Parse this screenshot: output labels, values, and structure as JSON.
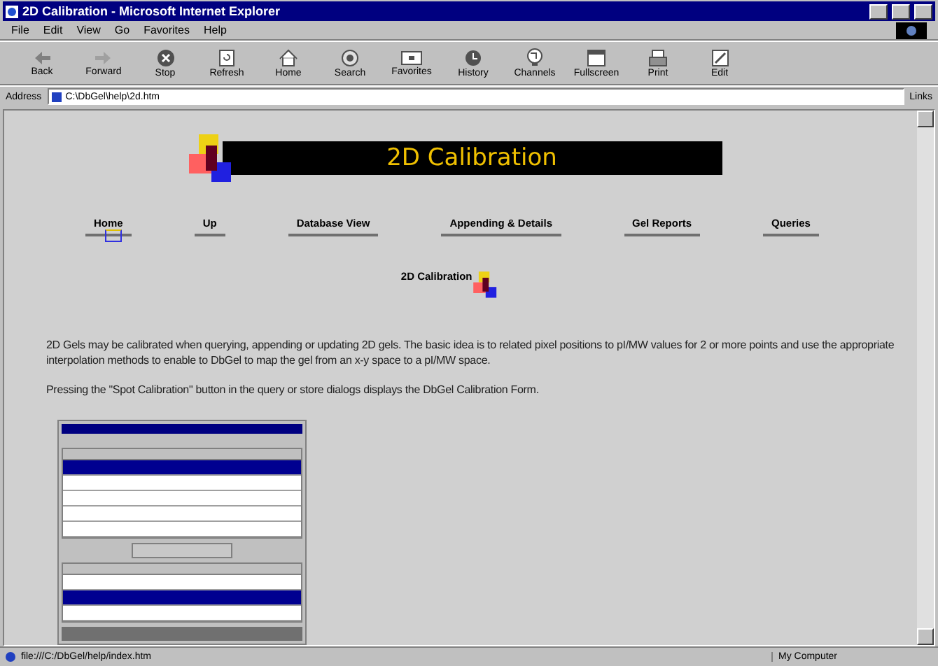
{
  "window": {
    "title": "2D Calibration - Microsoft Internet Explorer"
  },
  "menu": [
    "File",
    "Edit",
    "View",
    "Go",
    "Favorites",
    "Help"
  ],
  "toolbar": [
    {
      "label": "Back",
      "kind": "back"
    },
    {
      "label": "Forward",
      "kind": "forward"
    },
    {
      "label": "Stop",
      "kind": "stop"
    },
    {
      "label": "Refresh",
      "kind": "refresh"
    },
    {
      "label": "Home",
      "kind": "home"
    },
    {
      "label": "Search",
      "kind": "search"
    },
    {
      "label": "Favorites",
      "kind": "favorites"
    },
    {
      "label": "History",
      "kind": "history"
    },
    {
      "label": "Channels",
      "kind": "channels"
    },
    {
      "label": "Fullscreen",
      "kind": "fullscreen"
    },
    {
      "label": "Print",
      "kind": "print"
    },
    {
      "label": "Edit",
      "kind": "edit"
    }
  ],
  "address": {
    "label": "Address",
    "value": "C:\\DbGel\\help\\2d.htm",
    "links": "Links"
  },
  "page": {
    "banner": "2D Calibration",
    "nav": [
      {
        "label": "Home",
        "selected": true
      },
      {
        "label": "Up",
        "selected": false
      },
      {
        "label": "Database View",
        "selected": false
      },
      {
        "label": "Appending & Details",
        "selected": false
      },
      {
        "label": "Gel Reports",
        "selected": false
      },
      {
        "label": "Queries",
        "selected": false
      }
    ],
    "subnav": "2D Calibration",
    "paragraphs": [
      "2D Gels may be calibrated when querying, appending or updating 2D gels. The basic idea is to related pixel positions to pI/MW values for 2 or more points and use the appropriate interpolation methods to enable to DbGel to map the gel from an x-y space to a pI/MW space.",
      "Pressing the \"Spot Calibration\" button in the query or store dialogs displays the DbGel Calibration Form."
    ],
    "screenshot": {
      "grid_1_rows": [
        {
          "selected": true
        },
        {
          "selected": false
        },
        {
          "selected": false
        },
        {
          "selected": false
        },
        {
          "selected": false
        }
      ],
      "grid_2_rows": [
        {
          "selected": false
        },
        {
          "selected": true
        },
        {
          "selected": false
        }
      ]
    }
  },
  "status": {
    "text": "file:///C:/DbGel/help/index.htm",
    "zone": "My Computer"
  }
}
